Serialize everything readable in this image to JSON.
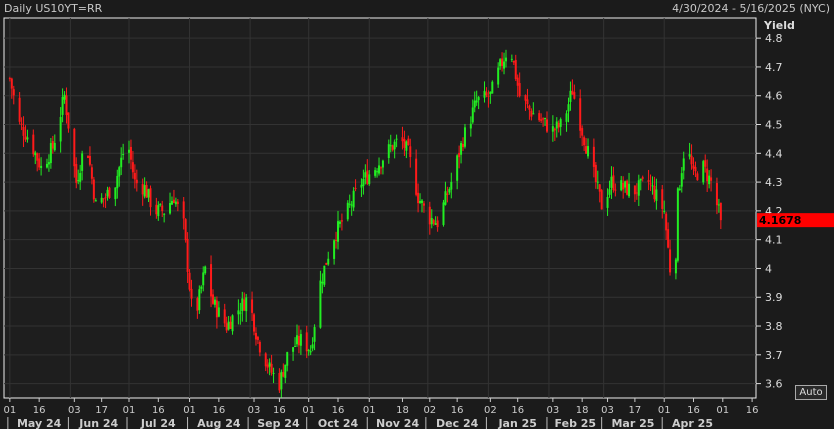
{
  "header": {
    "title": "Daily US10YT=RR",
    "range": "4/30/2024 - 5/16/2025 (NYC)"
  },
  "auto_label": "Auto",
  "chart_data": {
    "type": "candlestick",
    "title": "Daily US10YT=RR",
    "ylabel": "Yield",
    "ylim": [
      3.55,
      4.87
    ],
    "yticks": [
      "3.6",
      "3.7",
      "3.8",
      "3.9",
      "4",
      "4.1",
      "4.2",
      "4.3",
      "4.4",
      "4.5",
      "4.6",
      "4.7",
      "4.8"
    ],
    "last_value": "4.1678",
    "x_unit": "days since 2024-05-01",
    "xlim": [
      -3,
      382
    ],
    "day_ticks": [
      [
        0,
        "01"
      ],
      [
        15,
        "16"
      ],
      [
        33,
        "03"
      ],
      [
        47,
        "17"
      ],
      [
        61,
        "01"
      ],
      [
        76,
        "16"
      ],
      [
        92,
        "01"
      ],
      [
        107,
        "16"
      ],
      [
        125,
        "03"
      ],
      [
        138,
        "16"
      ],
      [
        153,
        "01"
      ],
      [
        168,
        "16"
      ],
      [
        184,
        "01"
      ],
      [
        201,
        "18"
      ],
      [
        215,
        "02"
      ],
      [
        229,
        "16"
      ],
      [
        246,
        "02"
      ],
      [
        260,
        "16"
      ],
      [
        278,
        "03"
      ],
      [
        293,
        "18"
      ],
      [
        306,
        "03"
      ],
      [
        320,
        "17"
      ],
      [
        335,
        "01"
      ],
      [
        350,
        "16"
      ],
      [
        365,
        "01"
      ],
      [
        380,
        "16"
      ]
    ],
    "months": [
      [
        0,
        30,
        "May 24"
      ],
      [
        31,
        60,
        "Jun 24"
      ],
      [
        61,
        91,
        "Jul 24"
      ],
      [
        92,
        122,
        "Aug 24"
      ],
      [
        123,
        152,
        "Sep 24"
      ],
      [
        153,
        183,
        "Oct 24"
      ],
      [
        184,
        213,
        "Nov 24"
      ],
      [
        214,
        244,
        "Dec 24"
      ],
      [
        245,
        275,
        "Jan 25"
      ],
      [
        276,
        303,
        "Feb 25"
      ],
      [
        304,
        334,
        "Mar 25"
      ],
      [
        335,
        364,
        "Apr 25"
      ]
    ],
    "close_path": [
      [
        0,
        4.66
      ],
      [
        5,
        4.5
      ],
      [
        10,
        4.45
      ],
      [
        16,
        4.35
      ],
      [
        22,
        4.42
      ],
      [
        28,
        4.6
      ],
      [
        34,
        4.3
      ],
      [
        39,
        4.45
      ],
      [
        44,
        4.22
      ],
      [
        49,
        4.25
      ],
      [
        54,
        4.3
      ],
      [
        60,
        4.45
      ],
      [
        64,
        4.3
      ],
      [
        69,
        4.28
      ],
      [
        74,
        4.2
      ],
      [
        79,
        4.2
      ],
      [
        84,
        4.25
      ],
      [
        89,
        4.15
      ],
      [
        94,
        3.8
      ],
      [
        100,
        4.0
      ],
      [
        104,
        3.88
      ],
      [
        111,
        3.8
      ],
      [
        116,
        3.85
      ],
      [
        122,
        3.9
      ],
      [
        127,
        3.75
      ],
      [
        133,
        3.65
      ],
      [
        138,
        3.6
      ],
      [
        143,
        3.72
      ],
      [
        149,
        3.75
      ],
      [
        154,
        3.72
      ],
      [
        159,
        3.95
      ],
      [
        165,
        4.1
      ],
      [
        173,
        4.2
      ],
      [
        180,
        4.3
      ],
      [
        187,
        4.35
      ],
      [
        195,
        4.42
      ],
      [
        200,
        4.45
      ],
      [
        204,
        4.4
      ],
      [
        209,
        4.25
      ],
      [
        214,
        4.18
      ],
      [
        219,
        4.16
      ],
      [
        226,
        4.3
      ],
      [
        232,
        4.45
      ],
      [
        239,
        4.58
      ],
      [
        246,
        4.6
      ],
      [
        251,
        4.7
      ],
      [
        256,
        4.78
      ],
      [
        261,
        4.6
      ],
      [
        266,
        4.55
      ],
      [
        271,
        4.52
      ],
      [
        278,
        4.48
      ],
      [
        283,
        4.5
      ],
      [
        288,
        4.62
      ],
      [
        293,
        4.48
      ],
      [
        298,
        4.35
      ],
      [
        303,
        4.22
      ],
      [
        308,
        4.3
      ],
      [
        314,
        4.28
      ],
      [
        320,
        4.27
      ],
      [
        327,
        4.3
      ],
      [
        335,
        4.2
      ],
      [
        338,
        4.0
      ],
      [
        340,
        3.87
      ],
      [
        342,
        4.25
      ],
      [
        346,
        4.45
      ],
      [
        350,
        4.32
      ],
      [
        355,
        4.35
      ],
      [
        359,
        4.3
      ],
      [
        364,
        4.1678
      ]
    ]
  }
}
